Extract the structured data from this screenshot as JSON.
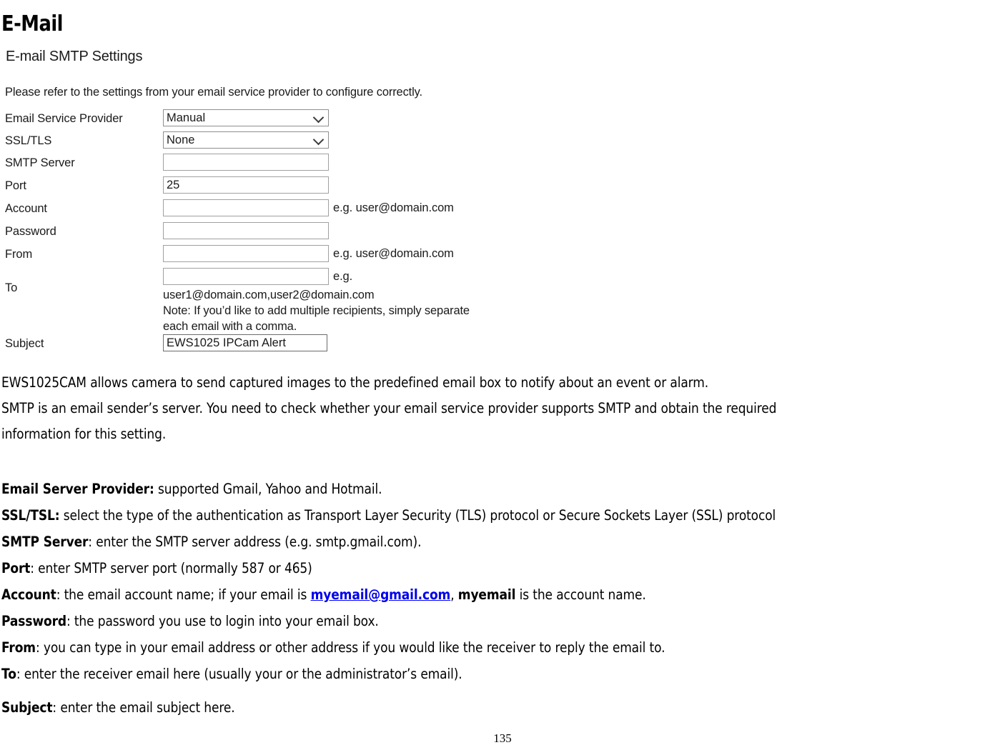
{
  "page": {
    "heading": "E-Mail",
    "number": "135"
  },
  "screenshot": {
    "title": "E-mail SMTP Settings",
    "intro": "Please refer to the settings from your email service provider to configure correctly.",
    "fields": [
      {
        "label": "Email Service Provider",
        "type": "select",
        "value": "Manual",
        "hint": "",
        "icon": "chevron-down-icon"
      },
      {
        "label": "SSL/TLS",
        "type": "select",
        "value": "None",
        "hint": "",
        "icon": "chevron-down-icon"
      },
      {
        "label": "SMTP Server",
        "type": "text",
        "value": "",
        "hint": ""
      },
      {
        "label": "Port",
        "type": "text",
        "value": "25",
        "hint": ""
      },
      {
        "label": "Account",
        "type": "text",
        "value": "",
        "hint": "e.g. user@domain.com"
      },
      {
        "label": "Password",
        "type": "text",
        "value": "",
        "hint": ""
      },
      {
        "label": "From",
        "type": "text",
        "value": "",
        "hint": "e.g. user@domain.com"
      },
      {
        "label": "To",
        "type": "text",
        "value": "",
        "hint": "e.g."
      },
      {
        "label": "Subject",
        "type": "text",
        "value": "EWS1025 IPCam Alert",
        "hint": ""
      }
    ],
    "to_notes": [
      "user1@domain.com,user2@domain.com",
      "Note: If you’d like to add multiple recipients, simply separate",
      "each email with a comma."
    ]
  },
  "body": {
    "intro_lines": [
      "EWS1025CAM allows camera to send captured images to the predefined email box to notify about an event or alarm.",
      "SMTP is an email sender’s server. You need to check whether your email service provider supports SMTP and obtain the required",
      "information for this setting."
    ],
    "definitions": [
      {
        "term": "Email Server Provider:",
        "rest": " supported Gmail, Yahoo and Hotmail."
      },
      {
        "term": "SSL/TSL:",
        "rest": " select the type of the authentication as Transport Layer Security (TLS) protocol or Secure Sockets Layer (SSL) protocol"
      },
      {
        "term": "SMTP Server",
        "rest": ": enter the SMTP server address (e.g. smtp.gmail.com)."
      },
      {
        "term": "Port",
        "rest": ": enter SMTP server port (normally 587 or 465)"
      },
      {
        "term": "Account",
        "rest": ": the email account name; if your email is ",
        "link": "myemail@gmail.com",
        "after_link": ", ",
        "bold_word": "myemail",
        "tail": " is the account name."
      },
      {
        "term": "Password",
        "rest": ": the password you use to login into your email box."
      },
      {
        "term": "From",
        "rest": ": you can type in your email address or other address if you would like the receiver to reply the email to."
      },
      {
        "term": "To",
        "rest": ": enter the receiver email here (usually your or the administrator’s email)."
      },
      {
        "term": "Subject",
        "rest": ": enter the email subject here."
      }
    ]
  },
  "colors": {
    "link": "#0000ee",
    "text": "#000000",
    "field_border": "#a0a0a0"
  }
}
